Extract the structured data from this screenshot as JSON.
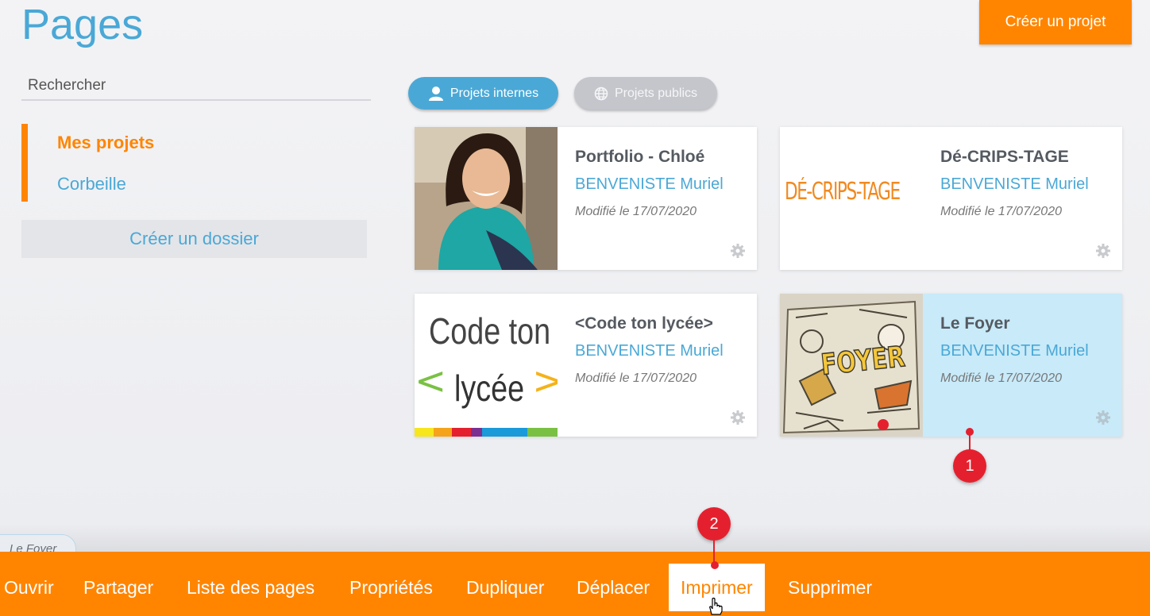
{
  "header": {
    "title": "Pages",
    "create_project_label": "Créer un projet"
  },
  "sidebar": {
    "search_placeholder": "Rechercher",
    "items": [
      {
        "label": "Mes projets",
        "active": true
      },
      {
        "label": "Corbeille",
        "active": false
      }
    ],
    "create_folder_label": "Créer un dossier"
  },
  "filters": {
    "internal_label": "Projets internes",
    "public_label": "Projets publics"
  },
  "projects": [
    {
      "title": "Portfolio - Chloé",
      "author": "BENVENISTE Muriel",
      "modified": "Modifié le 17/07/2020",
      "thumb": "portrait-photo"
    },
    {
      "title": "Dé-CRIPS-TAGE",
      "author": "BENVENISTE Muriel",
      "modified": "Modifié le 17/07/2020",
      "thumb": "handwritten-logo",
      "thumb_text": "DÉ-CRIPS-TAGE"
    },
    {
      "title": "<Code ton lycée>",
      "author": "BENVENISTE Muriel",
      "modified": "Modifié le 17/07/2020",
      "thumb": "code-ton-lycee-logo",
      "thumb_text_1": "Code ton",
      "thumb_text_2": "lycée"
    },
    {
      "title": "Le Foyer",
      "author": "BENVENISTE Muriel",
      "modified": "Modifié le 17/07/2020",
      "thumb": "foyer-drawing",
      "thumb_text": "FOYER",
      "selected": true
    }
  ],
  "selection_tab": "Le Foyer",
  "actions": [
    {
      "label": "Ouvrir"
    },
    {
      "label": "Partager"
    },
    {
      "label": "Liste des pages"
    },
    {
      "label": "Propriétés"
    },
    {
      "label": "Dupliquer"
    },
    {
      "label": "Déplacer"
    },
    {
      "label": "Imprimer",
      "highlighted": true
    },
    {
      "label": "Supprimer"
    }
  ],
  "markers": [
    "1",
    "2"
  ],
  "colors": {
    "accent": "#ff8500",
    "link": "#4aa8d6",
    "selected_card": "#c8eaf9",
    "marker": "#e5202e"
  }
}
